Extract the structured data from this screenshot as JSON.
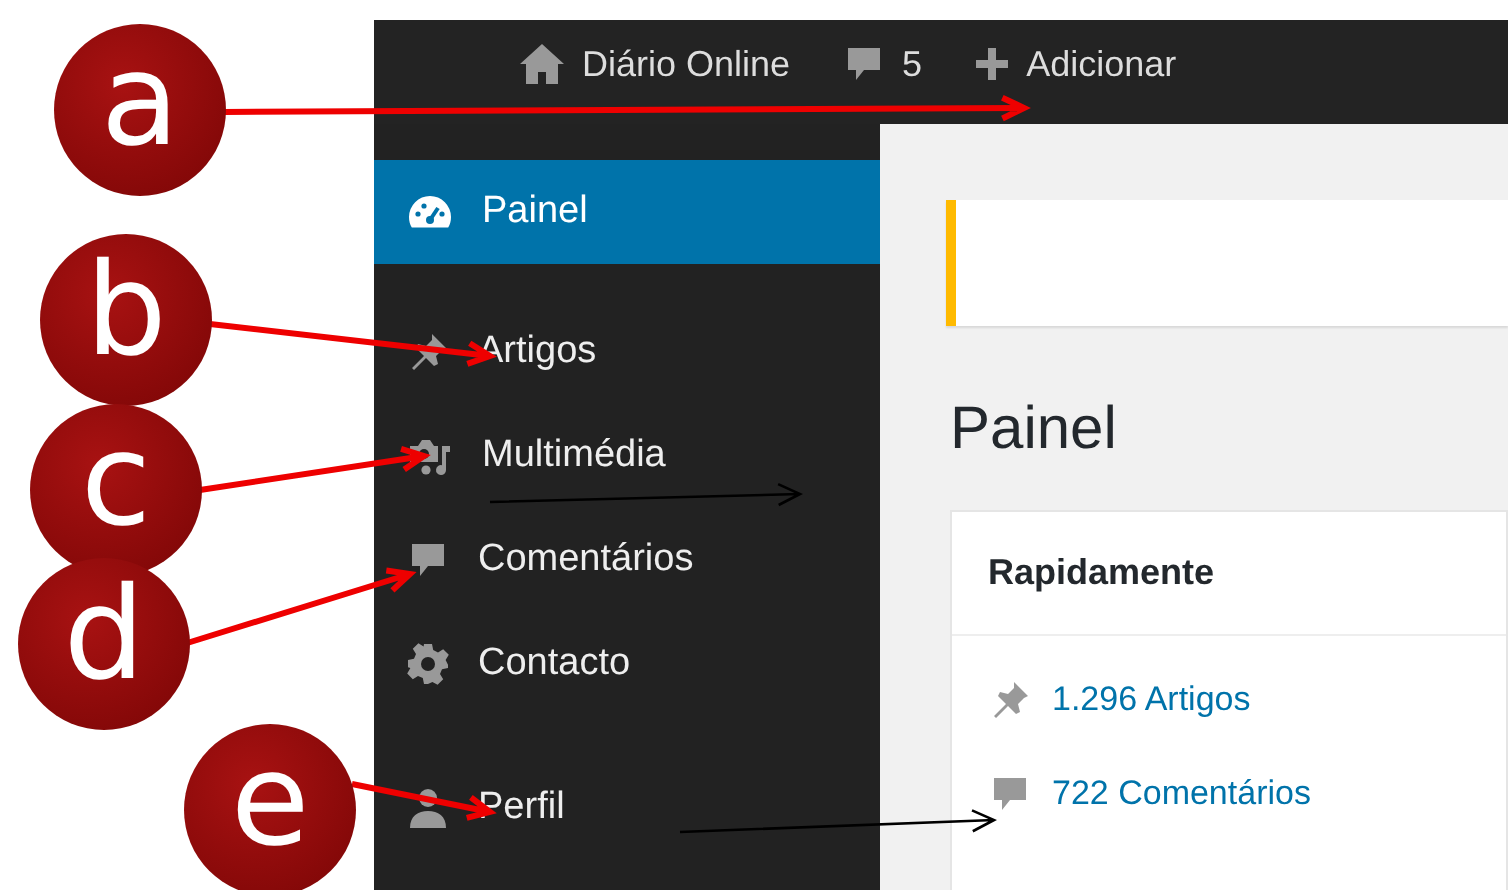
{
  "admin_bar": {
    "site_name": "Diário Online",
    "comments_count": "5",
    "new_label": "Adicionar"
  },
  "sidebar": {
    "items": [
      {
        "label": "Painel",
        "kind": "dashboard",
        "selected": true
      },
      {
        "label": "Artigos",
        "kind": "posts",
        "selected": false
      },
      {
        "label": "Multimédia",
        "kind": "media",
        "selected": false
      },
      {
        "label": "Comentários",
        "kind": "comments",
        "selected": false
      },
      {
        "label": "Contacto",
        "kind": "settings",
        "selected": false
      },
      {
        "label": "Perfil",
        "kind": "profile",
        "selected": false
      }
    ]
  },
  "page_title": "Painel",
  "widget": {
    "title": "Rapidamente",
    "items": [
      {
        "kind": "posts",
        "text": "1.296 Artigos"
      },
      {
        "kind": "comments",
        "text": "722 Comentários"
      }
    ]
  },
  "annotations": [
    {
      "letter": "a"
    },
    {
      "letter": "b"
    },
    {
      "letter": "c"
    },
    {
      "letter": "d"
    },
    {
      "letter": "e"
    }
  ]
}
